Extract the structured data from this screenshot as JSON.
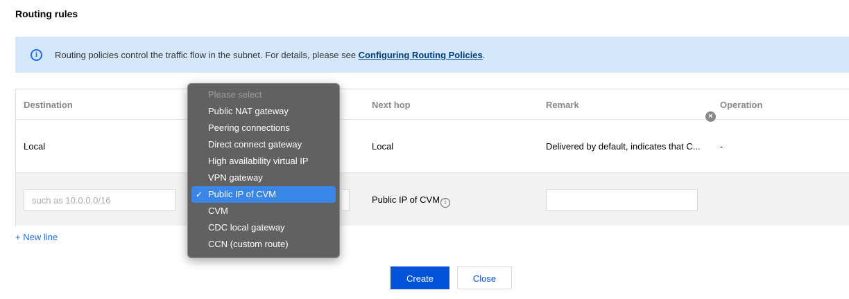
{
  "page": {
    "title": "Routing rules"
  },
  "notice": {
    "text": "Routing policies control the traffic flow in the subnet. For details, please see ",
    "link": "Configuring Routing Policies",
    "suffix": "."
  },
  "table": {
    "headers": {
      "destination": "Destination",
      "next_hop": "Next hop",
      "remark": "Remark",
      "operation": "Operation"
    },
    "rows": [
      {
        "destination": "Local",
        "next_hop": "Local",
        "remark": "Delivered by default, indicates that C...",
        "operation": "-"
      }
    ],
    "edit_row": {
      "destination_placeholder": "such as 10.0.0.0/16",
      "next_hop": "Public IP of CVM",
      "remark_value": ""
    }
  },
  "new_line_label": "+ New line",
  "buttons": {
    "create": "Create",
    "close": "Close"
  },
  "dropdown": {
    "placeholder": "Please select",
    "options": [
      "Public NAT gateway",
      "Peering connections",
      "Direct connect gateway",
      "High availability virtual IP",
      "VPN gateway",
      "Public IP of CVM",
      "CVM",
      "CDC local gateway",
      "CCN (custom route)"
    ],
    "selected": "Public IP of CVM"
  },
  "colors": {
    "accent": "#0052d9",
    "notice_bg": "#d5e7fd",
    "menu_bg": "#616161",
    "menu_selected": "#3a86e6"
  }
}
